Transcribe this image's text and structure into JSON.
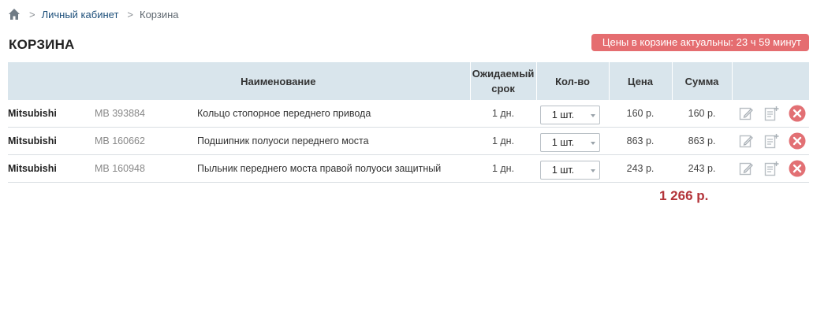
{
  "breadcrumb": {
    "home_icon": "home-icon",
    "separator": ">",
    "items": [
      {
        "label": "Личный кабинет"
      },
      {
        "label": "Корзина"
      }
    ]
  },
  "page": {
    "title": "КОРЗИНА",
    "timer_badge": "Цены в корзине актуальны: 23 ч 59 минут",
    "badge_color": "#e56d70"
  },
  "table": {
    "header_bg": "#d9e5ec",
    "columns": {
      "name": "Наименование",
      "delivery_line1": "Ожидаемый",
      "delivery_line2": "срок",
      "qty": "Кол-во",
      "price": "Цена",
      "sum": "Сумма"
    },
    "rows": [
      {
        "brand": "Mitsubishi",
        "article": "MB 393884",
        "name": "Кольцо стопорное переднего привода",
        "delivery": "1 дн.",
        "qty": "1 шт.",
        "price": "160 р.",
        "sum": "160 р."
      },
      {
        "brand": "Mitsubishi",
        "article": "MB 160662",
        "name": "Подшипник полуоси переднего моста",
        "delivery": "1 дн.",
        "qty": "1 шт.",
        "price": "863 р.",
        "sum": "863 р."
      },
      {
        "brand": "Mitsubishi",
        "article": "MB 160948",
        "name": "Пыльник переднего моста правой полуоси защитный",
        "delivery": "1 дн.",
        "qty": "1 шт.",
        "price": "243 р.",
        "sum": "243 р."
      }
    ],
    "row_actions": [
      "edit-icon",
      "add-note-icon",
      "delete-icon"
    ]
  },
  "total": {
    "value": "1 266 р.",
    "color": "#b3343a"
  }
}
